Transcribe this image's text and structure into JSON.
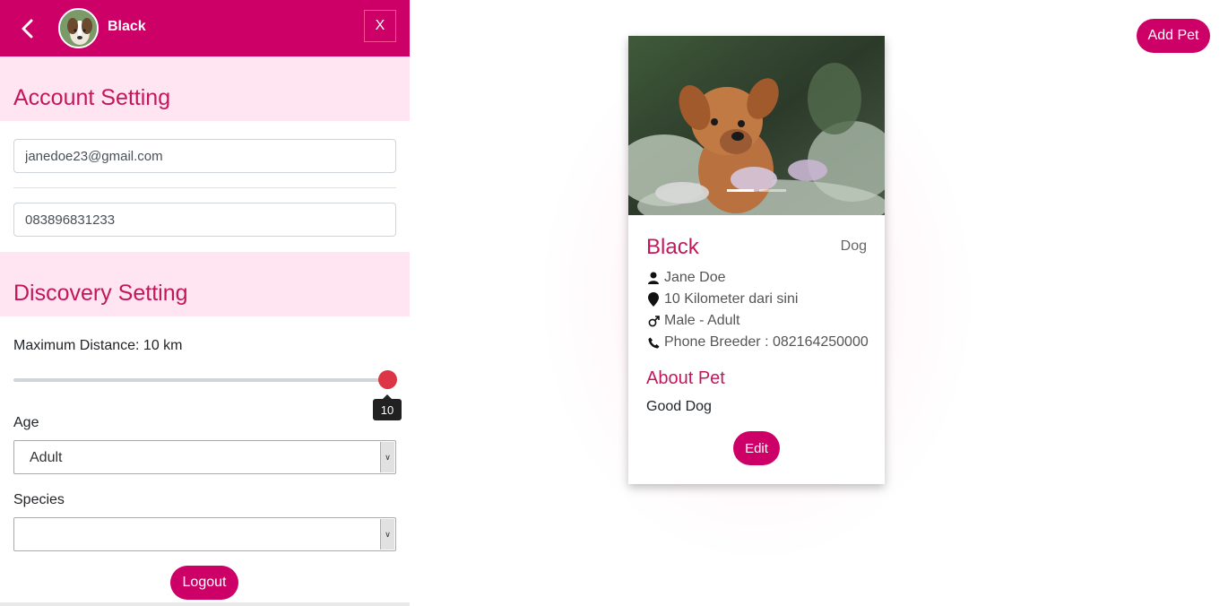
{
  "header": {
    "back_icon": "chevron-left-icon",
    "pet_name": "Black",
    "close_label": "X"
  },
  "account": {
    "title": "Account Setting",
    "email": "janedoe23@gmail.com",
    "phone": "083896831233"
  },
  "discovery": {
    "title": "Discovery Setting",
    "distance_label": "Maximum Distance: 10 km",
    "distance_value": "10",
    "distance_fraction": 1.0,
    "age_label": "Age",
    "age_value": "Adult",
    "species_label": "Species",
    "species_value": ""
  },
  "logout_label": "Logout",
  "add_pet_label": "Add Pet",
  "card": {
    "name": "Black",
    "species": "Dog",
    "owner": "Jane Doe",
    "distance": "10 Kilometer dari sini",
    "gender_age": "Male - Adult",
    "phone": "Phone Breeder : 082164250000",
    "about_title": "About Pet",
    "about_text": "Good Dog",
    "edit_label": "Edit"
  },
  "colors": {
    "brand": "#cc0066",
    "section_bg": "#ffe4f1",
    "heading": "#c2185b",
    "slider_thumb": "#dc3545"
  }
}
